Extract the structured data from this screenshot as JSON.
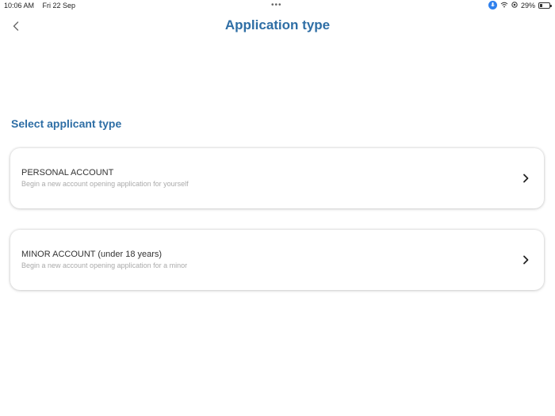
{
  "status_bar": {
    "time": "10:06 AM",
    "date": "Fri 22 Sep",
    "dots": "•••",
    "battery": "29%",
    "battery_level": 0.29,
    "icons": [
      "mic-icon",
      "wifi-icon",
      "location-icon",
      "battery-icon"
    ]
  },
  "header": {
    "title": "Application type",
    "back_icon": "chevron-left-icon"
  },
  "section": {
    "title": "Select applicant type"
  },
  "options": [
    {
      "title": "PERSONAL ACCOUNT",
      "subtitle": "Begin a new account opening application for yourself",
      "icon": "chevron-right-icon"
    },
    {
      "title": "MINOR ACCOUNT (under 18 years)",
      "subtitle": "Begin a new account opening application for a minor",
      "icon": "chevron-right-icon"
    }
  ],
  "colors": {
    "accent": "#2e6ea5",
    "subtitle": "#aaaaaa",
    "mic": "#2f80ed"
  }
}
